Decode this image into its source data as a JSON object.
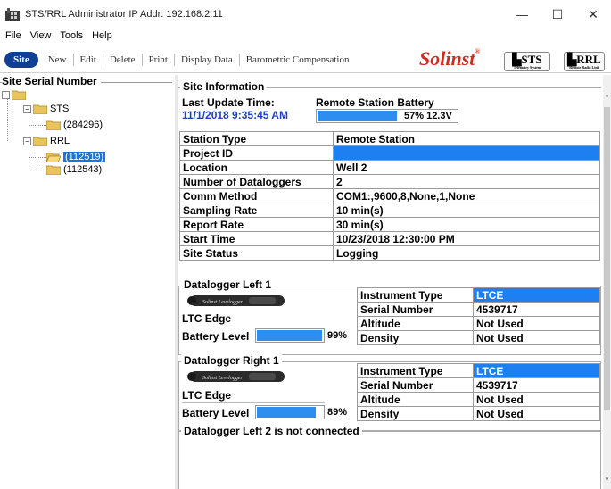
{
  "window": {
    "title": "STS/RRL Administrator IP Addr: 192.168.2.11",
    "minimize": "—",
    "maximize": "☐",
    "close": "✕"
  },
  "menu": [
    "File",
    "View",
    "Tools",
    "Help"
  ],
  "toolbar": {
    "site": "Site",
    "new": "New",
    "edit": "Edit",
    "delete": "Delete",
    "print": "Print",
    "display_data": "Display Data",
    "barometric": "Barometric Compensation",
    "logo_solinst": "Solinst",
    "logo_sts": "STS",
    "logo_sts_sub": "Telemetry System",
    "logo_rrl": "RRL",
    "logo_rrl_sub": "Remote Radio Link"
  },
  "tree": {
    "title": "Site Serial Number",
    "nodes": [
      {
        "label": "STS",
        "children": [
          "(284296)"
        ]
      },
      {
        "label": "RRL",
        "children": [
          "(112519)",
          "(112543)"
        ],
        "selected": "(112519)"
      }
    ]
  },
  "site_info": {
    "title": "Site Information",
    "last_update_label": "Last Update Time:",
    "last_update_value": "11/1/2018 9:35:45 AM",
    "battery_label": "Remote Station Battery",
    "battery_text": "57% 12.3V",
    "battery_fraction": 0.57,
    "rows": [
      {
        "key": "Station Type",
        "value": "Remote Station"
      },
      {
        "key": "Project ID",
        "value": ""
      },
      {
        "key": "Location",
        "value": "Well 2"
      },
      {
        "key": "Number of Dataloggers",
        "value": "2"
      },
      {
        "key": "Comm Method",
        "value": "COM1:,9600,8,None,1,None"
      },
      {
        "key": "Sampling Rate",
        "value": "10 min(s)"
      },
      {
        "key": "Report Rate",
        "value": "30 min(s)"
      },
      {
        "key": "Start Time",
        "value": "10/23/2018 12:30:00 PM"
      },
      {
        "key": "Site Status",
        "value": "Logging"
      }
    ]
  },
  "dataloggers": [
    {
      "title": "Datalogger Left 1",
      "model": "LTC Edge",
      "battery_label": "Battery Level",
      "battery_pct": "99%",
      "battery_fraction": 0.99,
      "probe_text": "Solinst Levelogger",
      "props": [
        {
          "key": "Instrument Type",
          "value": "LTCE"
        },
        {
          "key": "Serial Number",
          "value": "4539717"
        },
        {
          "key": "Altitude",
          "value": "Not Used"
        },
        {
          "key": "Density",
          "value": "Not Used"
        }
      ]
    },
    {
      "title": "Datalogger Right 1",
      "model": "LTC Edge",
      "battery_label": "Battery Level",
      "battery_pct": "89%",
      "battery_fraction": 0.89,
      "probe_text": "Solinst Levelogger",
      "props": [
        {
          "key": "Instrument Type",
          "value": "LTCE"
        },
        {
          "key": "Serial Number",
          "value": "4539717"
        },
        {
          "key": "Altitude",
          "value": "Not Used"
        },
        {
          "key": "Density",
          "value": "Not Used"
        }
      ]
    }
  ],
  "not_connected": "Datalogger Left 2 is not connected",
  "colors": {
    "accent": "#1e7ff0",
    "bar": "#2e8ef0",
    "site_button": "#123f96",
    "solinst_red": "#d42a1f",
    "date_blue": "#1f3fc8"
  }
}
